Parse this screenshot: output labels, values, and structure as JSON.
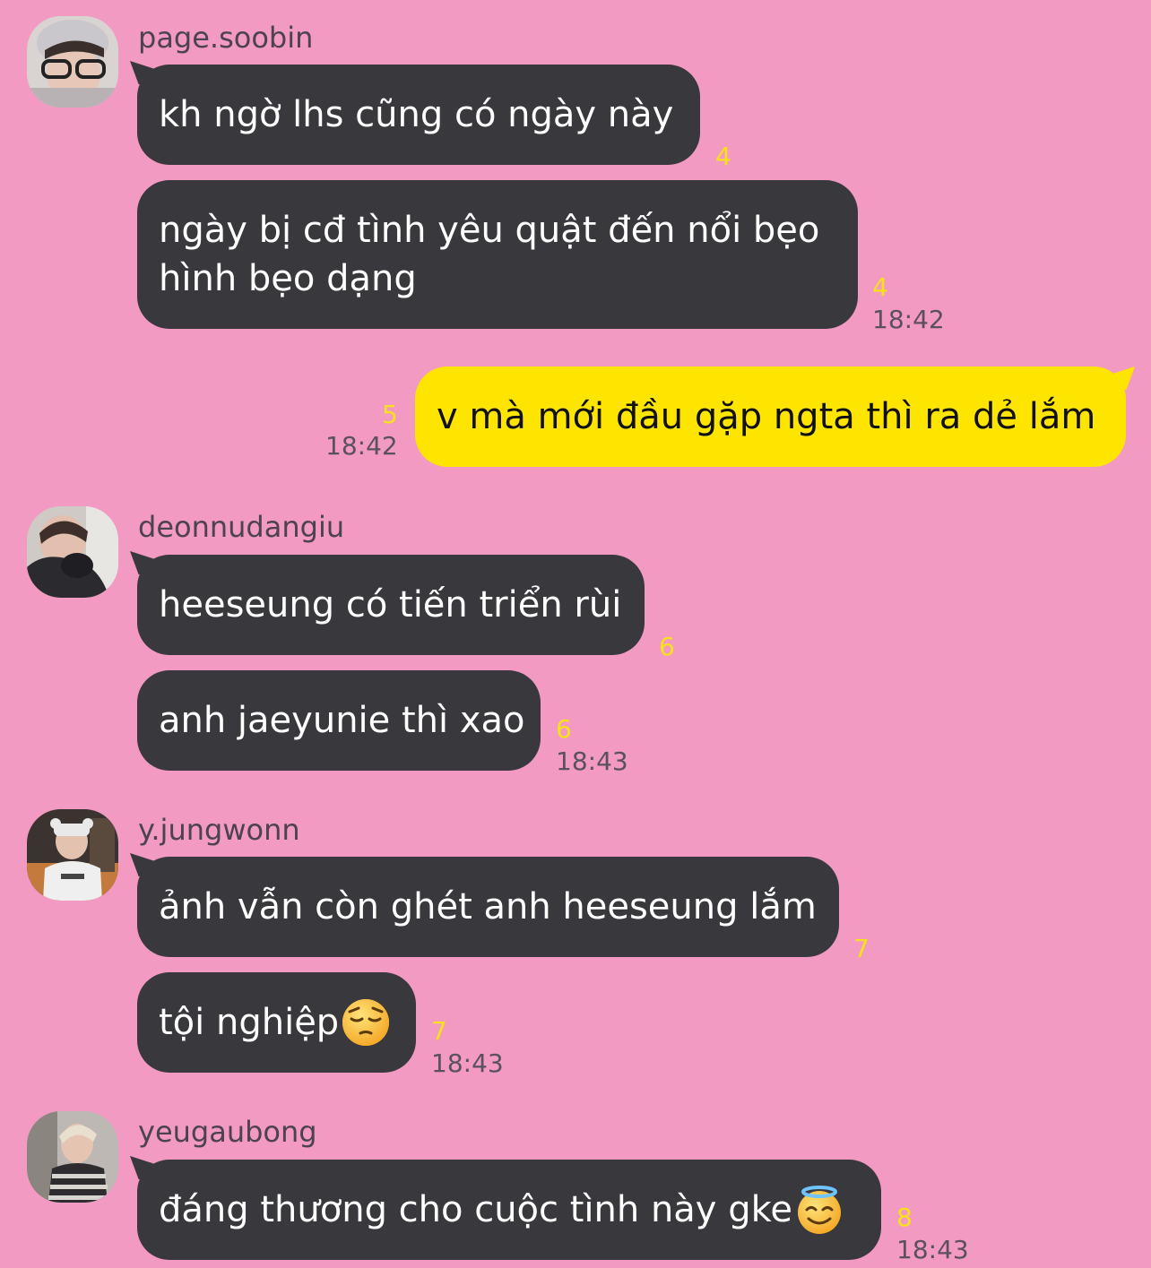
{
  "colors": {
    "background": "#f29ac2",
    "incoming_bubble": "#39383c",
    "outgoing_bubble": "#fee500",
    "unread_count": "#f7e11a",
    "timestamp": "#5b5060"
  },
  "groups": [
    {
      "sender": "page.soobin",
      "avatar_icon": "profile-photo",
      "messages": [
        {
          "text": "kh ngờ lhs cũng có ngày này",
          "unread": "4"
        },
        {
          "text": "ngày bị cđ tình yêu quật đến nổi bẹo hình bẹo dạng",
          "unread": "4",
          "time": "18:42"
        }
      ]
    },
    {
      "sender": "me",
      "messages": [
        {
          "text": "v mà mới đầu gặp ngta thì ra dẻ lắm",
          "unread": "5",
          "time": "18:42"
        }
      ]
    },
    {
      "sender": "deonnudangiu",
      "avatar_icon": "profile-photo",
      "messages": [
        {
          "text": "heeseung có tiến triển rùi",
          "unread": "6"
        },
        {
          "text": "anh jaeyunie thì xao",
          "unread": "6",
          "time": "18:43"
        }
      ]
    },
    {
      "sender": "y.jungwonn",
      "avatar_icon": "profile-photo",
      "messages": [
        {
          "text": "ảnh vẫn còn ghét anh heeseung lắm",
          "unread": "7"
        },
        {
          "text": "tội nghiệp",
          "emoji": "pensive-face-emoji",
          "unread": "7",
          "time": "18:43"
        }
      ]
    },
    {
      "sender": "yeugaubong",
      "avatar_icon": "profile-photo",
      "messages": [
        {
          "text": "đáng thương cho cuộc tình này gke",
          "emoji": "smiling-face-with-halo-emoji",
          "unread": "8",
          "time": "18:43"
        }
      ]
    }
  ]
}
